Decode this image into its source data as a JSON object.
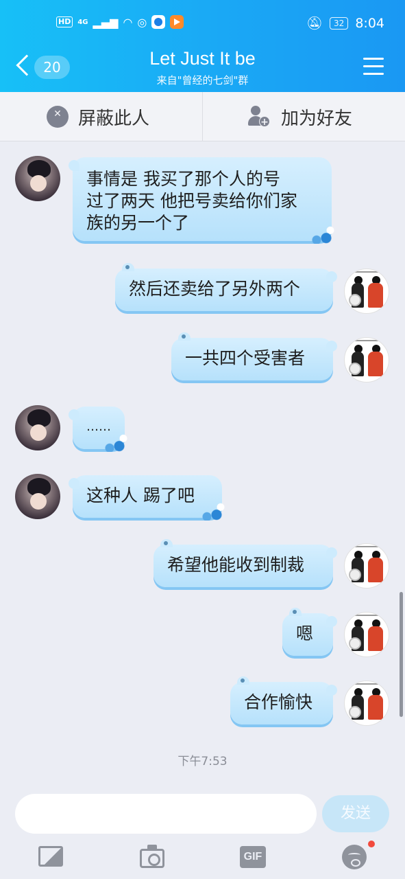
{
  "status_bar": {
    "left_badges": [
      "HD",
      "4G"
    ],
    "time": "8:04",
    "battery": "32"
  },
  "header": {
    "back_count": "20",
    "title": "Let Just It be",
    "subtitle": "来自\"曾经的七剑\"群"
  },
  "actions": {
    "block_label": "屏蔽此人",
    "add_friend_label": "加为好友"
  },
  "messages": [
    {
      "side": "recv",
      "lines": [
        "事情是  我买了那个人的号",
        "过了两天 他把号卖给你们家",
        "族的另一个了"
      ]
    },
    {
      "side": "sent",
      "lines": [
        "然后还卖给了另外两个"
      ]
    },
    {
      "side": "sent",
      "lines": [
        "一共四个受害者"
      ]
    },
    {
      "side": "recv",
      "lines": [
        "……"
      ]
    },
    {
      "side": "recv",
      "lines": [
        "这种人  踢了吧"
      ]
    },
    {
      "side": "sent",
      "lines": [
        "希望他能收到制裁"
      ]
    },
    {
      "side": "sent",
      "lines": [
        "嗯"
      ]
    },
    {
      "side": "sent",
      "lines": [
        "合作愉快"
      ]
    }
  ],
  "timestamp": "下午7:53",
  "composer": {
    "input_value": "",
    "send_label": "发送",
    "gif_label": "GIF"
  },
  "icons": {
    "block": "block-user-icon",
    "add_friend": "add-friend-icon",
    "image": "image-icon",
    "camera": "camera-icon",
    "gif": "gif-icon",
    "emoji": "emoji-icon"
  }
}
